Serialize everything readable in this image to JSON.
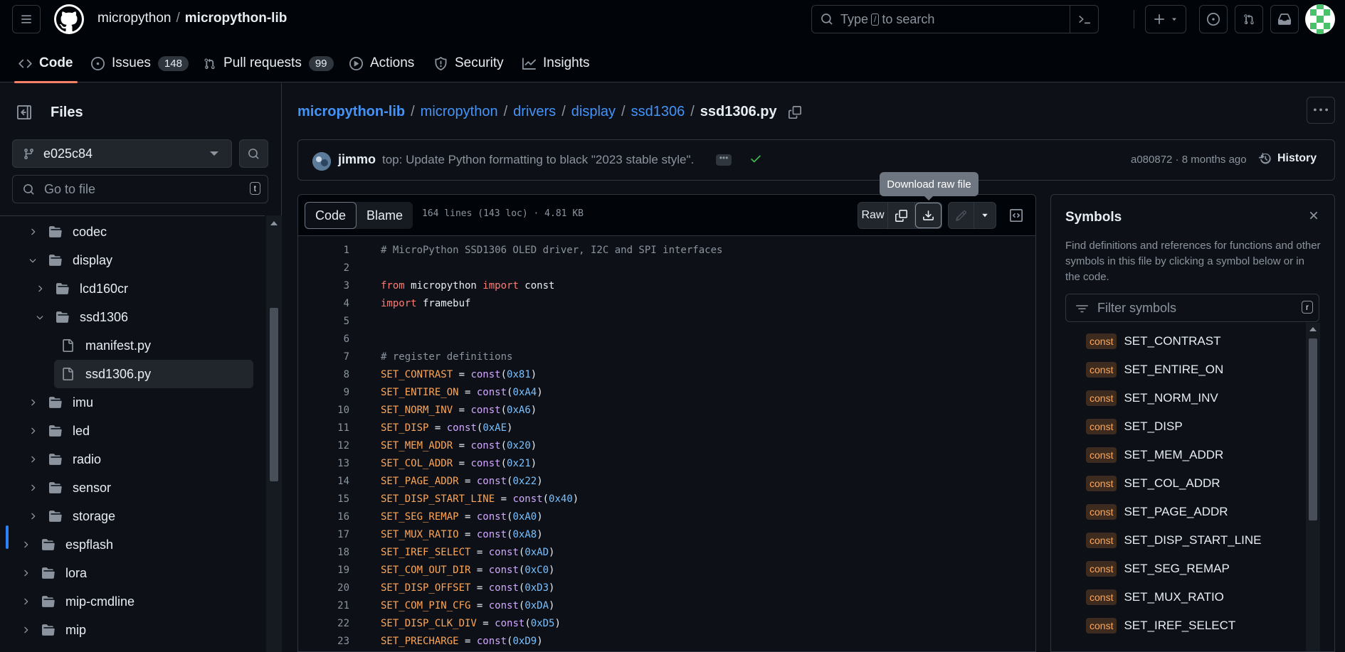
{
  "header": {
    "owner": "micropython",
    "separator": "/",
    "repo": "micropython-lib",
    "search_prefix": "Type",
    "search_key": "/",
    "search_suffix": "to search"
  },
  "tabs": [
    {
      "label": "Code",
      "icon": "code-icon"
    },
    {
      "label": "Issues",
      "count": "148",
      "icon": "issue-icon"
    },
    {
      "label": "Pull requests",
      "count": "99",
      "icon": "pull-request-icon"
    },
    {
      "label": "Actions",
      "icon": "play-icon"
    },
    {
      "label": "Security",
      "icon": "shield-icon"
    },
    {
      "label": "Insights",
      "icon": "graph-icon"
    }
  ],
  "sidebar": {
    "title": "Files",
    "branch": "e025c84",
    "goto_placeholder": "Go to file",
    "goto_key": "t",
    "tree": [
      {
        "label": "codec",
        "type": "folder",
        "expanded": false
      },
      {
        "label": "display",
        "type": "folder",
        "expanded": true
      },
      {
        "label": "lcd160cr",
        "type": "folder",
        "expanded": false
      },
      {
        "label": "ssd1306",
        "type": "folder",
        "expanded": true
      },
      {
        "label": "manifest.py",
        "type": "file"
      },
      {
        "label": "ssd1306.py",
        "type": "file",
        "selected": true
      },
      {
        "label": "imu",
        "type": "folder",
        "expanded": false
      },
      {
        "label": "led",
        "type": "folder",
        "expanded": false
      },
      {
        "label": "radio",
        "type": "folder",
        "expanded": false
      },
      {
        "label": "sensor",
        "type": "folder",
        "expanded": false
      },
      {
        "label": "storage",
        "type": "folder",
        "expanded": false
      },
      {
        "label": "espflash",
        "type": "folder",
        "expanded": false
      },
      {
        "label": "lora",
        "type": "folder",
        "expanded": false
      },
      {
        "label": "mip-cmdline",
        "type": "folder",
        "expanded": false
      },
      {
        "label": "mip",
        "type": "folder",
        "expanded": false
      }
    ]
  },
  "path": {
    "parts": [
      "micropython-lib",
      "micropython",
      "drivers",
      "display",
      "ssd1306"
    ],
    "separator": "/",
    "current": "ssd1306.py"
  },
  "commit": {
    "author": "jimmo",
    "message": "top: Update Python formatting to black \"2023 stable style\".",
    "ellipsis": "•••",
    "meta": "a080872 · 8 months ago",
    "history_label": "History"
  },
  "fileview": {
    "tab_code": "Code",
    "tab_blame": "Blame",
    "info": "164 lines (143 loc) · 4.81 KB",
    "raw_label": "Raw",
    "tooltip": "Download raw file"
  },
  "code_lines": [
    {
      "n": "1",
      "tokens": [
        [
          "cm",
          "# MicroPython SSD1306 OLED driver, I2C and SPI interfaces"
        ]
      ]
    },
    {
      "n": "2",
      "tokens": []
    },
    {
      "n": "3",
      "tokens": [
        [
          "kw",
          "from"
        ],
        [
          "",
          " micropython "
        ],
        [
          "kw",
          "import"
        ],
        [
          "",
          " const"
        ]
      ]
    },
    {
      "n": "4",
      "tokens": [
        [
          "kw",
          "import"
        ],
        [
          "",
          " framebuf"
        ]
      ]
    },
    {
      "n": "5",
      "tokens": []
    },
    {
      "n": "6",
      "tokens": []
    },
    {
      "n": "7",
      "tokens": [
        [
          "cm",
          "# register definitions"
        ]
      ]
    },
    {
      "n": "8",
      "tokens": [
        [
          "cn",
          "SET_CONTRAST"
        ],
        [
          "",
          " = "
        ],
        [
          "fn",
          "const"
        ],
        [
          "",
          "("
        ],
        [
          "nm",
          "0x81"
        ],
        [
          "",
          ")"
        ]
      ]
    },
    {
      "n": "9",
      "tokens": [
        [
          "cn",
          "SET_ENTIRE_ON"
        ],
        [
          "",
          " = "
        ],
        [
          "fn",
          "const"
        ],
        [
          "",
          "("
        ],
        [
          "nm",
          "0xA4"
        ],
        [
          "",
          ")"
        ]
      ]
    },
    {
      "n": "10",
      "tokens": [
        [
          "cn",
          "SET_NORM_INV"
        ],
        [
          "",
          " = "
        ],
        [
          "fn",
          "const"
        ],
        [
          "",
          "("
        ],
        [
          "nm",
          "0xA6"
        ],
        [
          "",
          ")"
        ]
      ]
    },
    {
      "n": "11",
      "tokens": [
        [
          "cn",
          "SET_DISP"
        ],
        [
          "",
          " = "
        ],
        [
          "fn",
          "const"
        ],
        [
          "",
          "("
        ],
        [
          "nm",
          "0xAE"
        ],
        [
          "",
          ")"
        ]
      ]
    },
    {
      "n": "12",
      "tokens": [
        [
          "cn",
          "SET_MEM_ADDR"
        ],
        [
          "",
          " = "
        ],
        [
          "fn",
          "const"
        ],
        [
          "",
          "("
        ],
        [
          "nm",
          "0x20"
        ],
        [
          "",
          ")"
        ]
      ]
    },
    {
      "n": "13",
      "tokens": [
        [
          "cn",
          "SET_COL_ADDR"
        ],
        [
          "",
          " = "
        ],
        [
          "fn",
          "const"
        ],
        [
          "",
          "("
        ],
        [
          "nm",
          "0x21"
        ],
        [
          "",
          ")"
        ]
      ]
    },
    {
      "n": "14",
      "tokens": [
        [
          "cn",
          "SET_PAGE_ADDR"
        ],
        [
          "",
          " = "
        ],
        [
          "fn",
          "const"
        ],
        [
          "",
          "("
        ],
        [
          "nm",
          "0x22"
        ],
        [
          "",
          ")"
        ]
      ]
    },
    {
      "n": "15",
      "tokens": [
        [
          "cn",
          "SET_DISP_START_LINE"
        ],
        [
          "",
          " = "
        ],
        [
          "fn",
          "const"
        ],
        [
          "",
          "("
        ],
        [
          "nm",
          "0x40"
        ],
        [
          "",
          ")"
        ]
      ]
    },
    {
      "n": "16",
      "tokens": [
        [
          "cn",
          "SET_SEG_REMAP"
        ],
        [
          "",
          " = "
        ],
        [
          "fn",
          "const"
        ],
        [
          "",
          "("
        ],
        [
          "nm",
          "0xA0"
        ],
        [
          "",
          ")"
        ]
      ]
    },
    {
      "n": "17",
      "tokens": [
        [
          "cn",
          "SET_MUX_RATIO"
        ],
        [
          "",
          " = "
        ],
        [
          "fn",
          "const"
        ],
        [
          "",
          "("
        ],
        [
          "nm",
          "0xA8"
        ],
        [
          "",
          ")"
        ]
      ]
    },
    {
      "n": "18",
      "tokens": [
        [
          "cn",
          "SET_IREF_SELECT"
        ],
        [
          "",
          " = "
        ],
        [
          "fn",
          "const"
        ],
        [
          "",
          "("
        ],
        [
          "nm",
          "0xAD"
        ],
        [
          "",
          ")"
        ]
      ]
    },
    {
      "n": "19",
      "tokens": [
        [
          "cn",
          "SET_COM_OUT_DIR"
        ],
        [
          "",
          " = "
        ],
        [
          "fn",
          "const"
        ],
        [
          "",
          "("
        ],
        [
          "nm",
          "0xC0"
        ],
        [
          "",
          ")"
        ]
      ]
    },
    {
      "n": "20",
      "tokens": [
        [
          "cn",
          "SET_DISP_OFFSET"
        ],
        [
          "",
          " = "
        ],
        [
          "fn",
          "const"
        ],
        [
          "",
          "("
        ],
        [
          "nm",
          "0xD3"
        ],
        [
          "",
          ")"
        ]
      ]
    },
    {
      "n": "21",
      "tokens": [
        [
          "cn",
          "SET_COM_PIN_CFG"
        ],
        [
          "",
          " = "
        ],
        [
          "fn",
          "const"
        ],
        [
          "",
          "("
        ],
        [
          "nm",
          "0xDA"
        ],
        [
          "",
          ")"
        ]
      ]
    },
    {
      "n": "22",
      "tokens": [
        [
          "cn",
          "SET_DISP_CLK_DIV"
        ],
        [
          "",
          " = "
        ],
        [
          "fn",
          "const"
        ],
        [
          "",
          "("
        ],
        [
          "nm",
          "0xD5"
        ],
        [
          "",
          ")"
        ]
      ]
    },
    {
      "n": "23",
      "tokens": [
        [
          "cn",
          "SET_PRECHARGE"
        ],
        [
          "",
          " = "
        ],
        [
          "fn",
          "const"
        ],
        [
          "",
          "("
        ],
        [
          "nm",
          "0xD9"
        ],
        [
          "",
          ")"
        ]
      ]
    }
  ],
  "symbols": {
    "title": "Symbols",
    "description": "Find definitions and references for functions and other symbols in this file by clicking a symbol below or in the code.",
    "filter_placeholder": "Filter symbols",
    "filter_key": "r",
    "badge": "const",
    "items": [
      "SET_CONTRAST",
      "SET_ENTIRE_ON",
      "SET_NORM_INV",
      "SET_DISP",
      "SET_MEM_ADDR",
      "SET_COL_ADDR",
      "SET_PAGE_ADDR",
      "SET_DISP_START_LINE",
      "SET_SEG_REMAP",
      "SET_MUX_RATIO",
      "SET_IREF_SELECT"
    ]
  },
  "colors": {
    "accent": "#f78166",
    "link": "#4493f8",
    "success": "#3fb950",
    "background": "#0d1117"
  }
}
